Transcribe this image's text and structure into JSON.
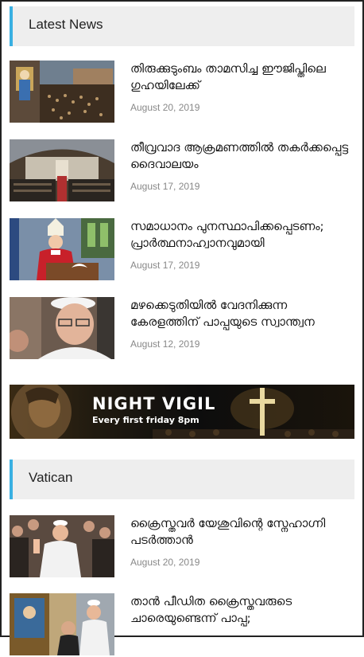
{
  "latest_news": {
    "heading": "Latest News",
    "items": [
      {
        "title": "തിരുക്കുടുംബം താമസിച്ച ഈജിപ്തിലെ ഗുഹയിലേക്ക്",
        "date": "August 20, 2019"
      },
      {
        "title": "തീവ്രവാദ ആക്രമണത്തിൽ തകർക്കപ്പെട്ട ദൈവാലയം",
        "date": "August 17, 2019"
      },
      {
        "title": "സമാധാനം പുനസ്ഥാപിക്കപ്പെടണം; പ്രാർത്ഥനാഹ്വാനവുമായി",
        "date": "August 17, 2019"
      },
      {
        "title": "മഴക്കെടുതിയിൽ വേദനിക്കുന്ന കേരളത്തിന് പാപ്പയുടെ സ്വാന്ത്വന",
        "date": "August 12, 2019"
      }
    ]
  },
  "banner": {
    "title": "NIGHT VIGIL",
    "subtitle": "Every first friday 8pm"
  },
  "vatican": {
    "heading": "Vatican",
    "items": [
      {
        "title": "ക്രൈസ്തവർ യേശുവിന്റെ സ്നേഹാഗ്നി പടർത്താൻ",
        "date": "August 20, 2019"
      },
      {
        "title": "താൻ പീഡിത ക്രൈസ്തവരുടെ ചാരെയുണ്ടെന്ന് പാപ്പ;",
        "date": ""
      }
    ]
  },
  "colors": {
    "accent": "#3ab0e2",
    "header_bg": "#eeeeee",
    "date": "#888888"
  }
}
